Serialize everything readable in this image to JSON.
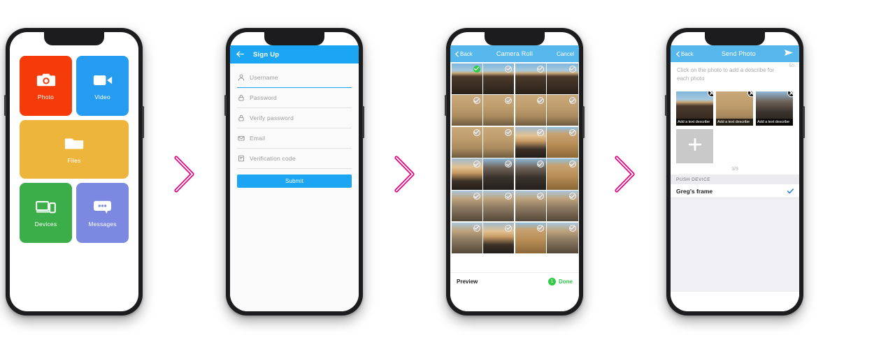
{
  "colors": {
    "arrow_magenta": "#E6007E",
    "blue_nav": "#1CA5F3",
    "blue_nav_light": "#56B7EC",
    "tile_photo": "#F63B0B",
    "tile_video": "#269CF0",
    "tile_files": "#EDB53B",
    "tile_devices": "#3BAE49",
    "tile_messages": "#7C89E1",
    "green_accent": "#2ECC47",
    "phone_frame": "#1C1C1E"
  },
  "flow": {
    "arrow_icon": "chevron-right-icon",
    "arrow_count": 3
  },
  "screens": [
    {
      "id": "home",
      "name": "home-tiles-screen",
      "tiles": [
        {
          "label": "Photo",
          "icon": "camera-icon",
          "color": "#F63B0B",
          "size": "half"
        },
        {
          "label": "Video",
          "icon": "video-icon",
          "color": "#269CF0",
          "size": "half"
        },
        {
          "label": "Files",
          "icon": "folder-icon",
          "color": "#EDB53B",
          "size": "full"
        },
        {
          "label": "Devices",
          "icon": "devices-icon",
          "color": "#3BAE49",
          "size": "half"
        },
        {
          "label": "Messages",
          "icon": "message-icon",
          "color": "#7C89E1",
          "size": "half"
        }
      ]
    },
    {
      "id": "signup",
      "name": "sign-up-screen",
      "nav": {
        "title": "Sign Up",
        "back_icon": "arrow-left-icon"
      },
      "fields": [
        {
          "placeholder": "Username",
          "icon": "user-icon",
          "active": true
        },
        {
          "placeholder": "Password",
          "icon": "lock-icon",
          "active": false
        },
        {
          "placeholder": "Verify password",
          "icon": "lock-icon",
          "active": false
        },
        {
          "placeholder": "Email",
          "icon": "envelope-icon",
          "active": false
        },
        {
          "placeholder": "Verification code",
          "icon": "form-icon",
          "active": false
        }
      ],
      "submit_label": "Submit"
    },
    {
      "id": "cameraroll",
      "name": "camera-roll-screen",
      "nav": {
        "back": "Back",
        "title": "Camera Roll",
        "cancel": "Cancel",
        "back_icon": "chevron-left-icon"
      },
      "grid": {
        "columns": 4,
        "rows": 6,
        "cells": [
          {
            "selected": true,
            "scene": "cliff-sunset"
          },
          {
            "selected": false,
            "scene": "cliff-sunset"
          },
          {
            "selected": false,
            "scene": "cliff-sunset"
          },
          {
            "selected": false,
            "scene": "cliff-sunset"
          },
          {
            "selected": false,
            "scene": "kids-rock"
          },
          {
            "selected": false,
            "scene": "kids-rock"
          },
          {
            "selected": false,
            "scene": "kids-rock"
          },
          {
            "selected": false,
            "scene": "kids-rock"
          },
          {
            "selected": false,
            "scene": "kids-rock"
          },
          {
            "selected": false,
            "scene": "kids-rock"
          },
          {
            "selected": false,
            "scene": "beach-sunrise"
          },
          {
            "selected": false,
            "scene": "desert-dune"
          },
          {
            "selected": false,
            "scene": "beach-sunrise"
          },
          {
            "selected": false,
            "scene": "couple-selfie"
          },
          {
            "selected": false,
            "scene": "couple-selfie"
          },
          {
            "selected": false,
            "scene": "desert-dune"
          },
          {
            "selected": false,
            "scene": "group-selfie"
          },
          {
            "selected": false,
            "scene": "group-selfie"
          },
          {
            "selected": false,
            "scene": "group-selfie"
          },
          {
            "selected": false,
            "scene": "group-selfie"
          },
          {
            "selected": false,
            "scene": "group-selfie"
          },
          {
            "selected": false,
            "scene": "beach-sunrise"
          },
          {
            "selected": false,
            "scene": "desert-dune"
          },
          {
            "selected": false,
            "scene": "group-selfie"
          }
        ]
      },
      "footer": {
        "preview": "Preview",
        "count": "1",
        "done": "Done"
      }
    },
    {
      "id": "sendphoto",
      "name": "send-photo-screen",
      "nav": {
        "back": "Back",
        "title": "Send Photo",
        "send_icon": "send-icon",
        "back_icon": "chevron-left-icon"
      },
      "note_text": "Click on the photo to add a describe for each photo",
      "char_count": "50",
      "thumbs": [
        {
          "caption": "Add a text describe",
          "scene": "cliff-sunset",
          "remove_icon": "close-circle-icon"
        },
        {
          "caption": "Add a text describe",
          "scene": "kids-rock",
          "remove_icon": "close-circle-icon"
        },
        {
          "caption": "Add a text describe",
          "scene": "couple-selfie",
          "remove_icon": "close-circle-icon"
        }
      ],
      "add_tile_icon": "plus-icon",
      "counter": "3/9",
      "section_header": "PUSH DEVICE",
      "device": {
        "name": "Greg's frame",
        "checked": true,
        "check_icon": "check-icon"
      }
    }
  ]
}
